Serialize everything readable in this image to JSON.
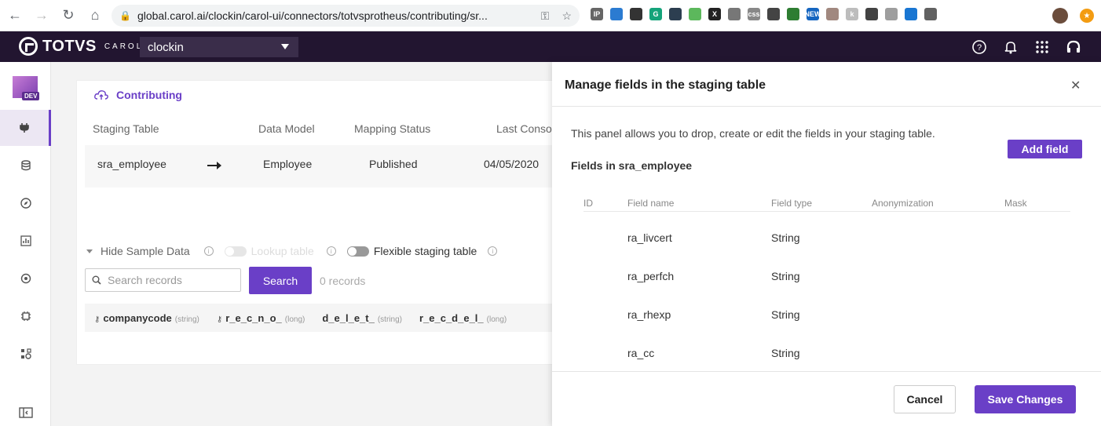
{
  "browser": {
    "url": "global.carol.ai/clockin/carol-ui/connectors/totvsprotheus/contributing/sr...",
    "extensions": [
      {
        "name": "ip-ext-icon",
        "label": "IP",
        "color": "#666666"
      },
      {
        "name": "calendar-ext-icon",
        "label": "",
        "color": "#2b7bd1"
      },
      {
        "name": "qr-ext-icon",
        "label": "",
        "color": "#333333"
      },
      {
        "name": "grammarly-ext-icon",
        "label": "G",
        "color": "#15a37a"
      },
      {
        "name": "dark-ext-icon",
        "label": "",
        "color": "#2c3e50"
      },
      {
        "name": "sheet-ext-icon",
        "label": "",
        "color": "#5cb85c"
      },
      {
        "name": "x-ext-icon",
        "label": "X",
        "color": "#222222"
      },
      {
        "name": "bulb-ext-icon",
        "label": "",
        "color": "#777777"
      },
      {
        "name": "css-ext-icon",
        "label": "css",
        "color": "#888888"
      },
      {
        "name": "book-ext-icon",
        "label": "",
        "color": "#444444"
      },
      {
        "name": "puzzle-ext-icon",
        "label": "",
        "color": "#2e7d32"
      },
      {
        "name": "new-ext-icon",
        "label": "NEW",
        "color": "#1565c0"
      },
      {
        "name": "box-ext-icon",
        "label": "",
        "color": "#a1887f"
      },
      {
        "name": "k-ext-icon",
        "label": "k",
        "color": "#bdbdbd"
      },
      {
        "name": "contrast-ext-icon",
        "label": "",
        "color": "#424242"
      },
      {
        "name": "camera-ext-icon",
        "label": "",
        "color": "#9e9e9e"
      },
      {
        "name": "grid-ext-icon",
        "label": "",
        "color": "#1976d2"
      },
      {
        "name": "circle-ext-icon",
        "label": "",
        "color": "#616161"
      }
    ]
  },
  "header": {
    "tenant": "clockin"
  },
  "sidebar": {
    "env_tag": "DEV"
  },
  "card": {
    "title": "Contributing",
    "columns": [
      "Staging Table",
      "Data Model",
      "Mapping Status",
      "Last Conso"
    ],
    "row": {
      "staging_table": "sra_employee",
      "data_model": "Employee",
      "mapping_status": "Published",
      "last_consolidated": "04/05/2020"
    },
    "hide_sample_data": "Hide Sample Data",
    "lookup_table": "Lookup table",
    "flexible_staging_table": "Flexible staging table",
    "search_placeholder": "Search records",
    "search_button": "Search",
    "records_count": "0 records",
    "sample_columns": [
      {
        "name": "companycode",
        "type": "(string)",
        "key": true
      },
      {
        "name": "r_e_c_n_o_",
        "type": "(long)",
        "key": true
      },
      {
        "name": "d_e_l_e_t_",
        "type": "(string)",
        "key": false
      },
      {
        "name": "r_e_c_d_e_l_",
        "type": "(long)",
        "key": false
      }
    ]
  },
  "panel": {
    "title": "Manage fields in the staging table",
    "description": "This panel allows you to drop, create or edit the fields in your staging table.",
    "add_field": "Add field",
    "subtitle": "Fields in sra_employee",
    "table_headers": {
      "id": "ID",
      "field_name": "Field name",
      "field_type": "Field type",
      "anonymization": "Anonymization",
      "mask": "Mask"
    },
    "fields": [
      {
        "name": "ra_livcert",
        "type": "String"
      },
      {
        "name": "ra_perfch",
        "type": "String"
      },
      {
        "name": "ra_rhexp",
        "type": "String"
      },
      {
        "name": "ra_cc",
        "type": "String"
      }
    ],
    "cancel": "Cancel",
    "save": "Save Changes"
  },
  "colors": {
    "accent": "#6a3fc7",
    "header_bg": "#221530"
  }
}
